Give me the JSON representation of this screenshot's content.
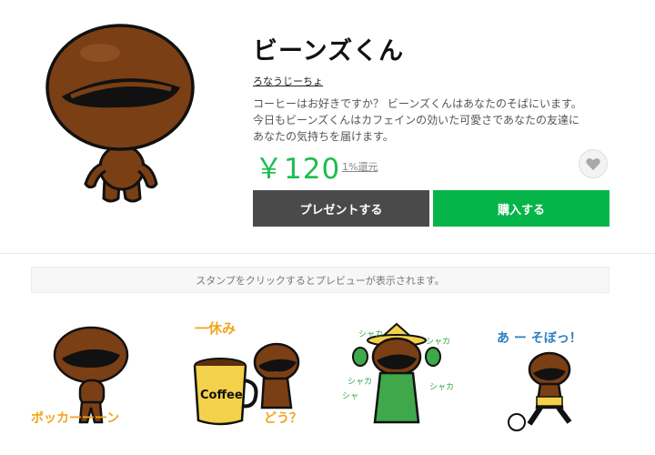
{
  "product": {
    "title": "ビーンズくん",
    "author": "ろなうじーちょ",
    "description": [
      "コーヒーはお好きですか？ ビーンズくんはあなたのそばにいます。",
      "今日もビーンズくんはカフェインの効いた可愛さであなたの友達に",
      "あなたの気持ちを届けます。"
    ],
    "price": "￥120",
    "rebate": "1%還元"
  },
  "actions": {
    "gift_label": "プレゼントする",
    "buy_label": "購入する",
    "favorite_icon": "heart-icon"
  },
  "preview_hint": "スタンプをクリックするとプレビューが表示されます。",
  "stamps": [
    {
      "caption": "ポッカーーーン"
    },
    {
      "caption_top": "一休み",
      "cup_label": "Coffee",
      "caption_bottom": "どう？"
    },
    {
      "sfx": [
        "シャカ",
        "シャカ",
        "シャカ",
        "シャ",
        "シャカ"
      ]
    },
    {
      "caption": "あ ー そぼっ！"
    }
  ],
  "colors": {
    "accent_green": "#06b54a",
    "price_green": "#1dbd4f",
    "gift_button": "#4a4a4a",
    "bean_brown": "#7a3f14"
  }
}
